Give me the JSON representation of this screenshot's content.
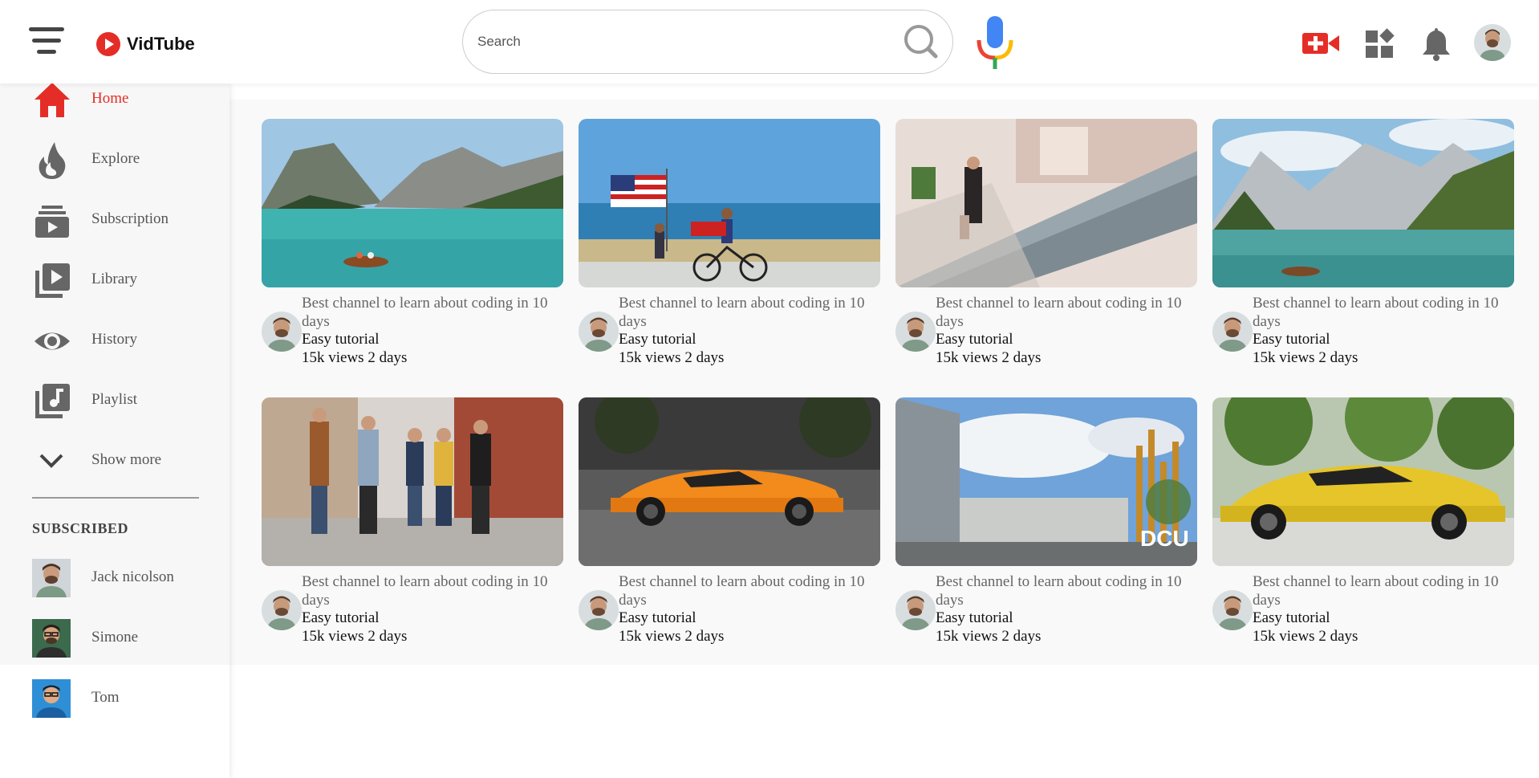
{
  "app": {
    "name": "VidTube",
    "brand_color": "#e52d27"
  },
  "header": {
    "menu_icon": "hamburger-icon",
    "search": {
      "placeholder": "Search",
      "value": "",
      "icon": "search-icon"
    },
    "mic_icon": "mic-icon",
    "actions": [
      {
        "name": "upload-video",
        "icon": "video-add-icon"
      },
      {
        "name": "apps",
        "icon": "apps-grid-icon"
      },
      {
        "name": "notifications",
        "icon": "bell-icon"
      },
      {
        "name": "account",
        "icon": "avatar"
      }
    ]
  },
  "sidebar": {
    "items": [
      {
        "label": "Home",
        "icon": "home-icon",
        "active": true
      },
      {
        "label": "Explore",
        "icon": "flame-icon",
        "active": false
      },
      {
        "label": "Subscription",
        "icon": "subscription-icon",
        "active": false
      },
      {
        "label": "Library",
        "icon": "library-icon",
        "active": false
      },
      {
        "label": "History",
        "icon": "eye-icon",
        "active": false
      },
      {
        "label": "Playlist",
        "icon": "playlist-icon",
        "active": false
      },
      {
        "label": "Show more",
        "icon": "chevron-down-icon",
        "active": false
      }
    ],
    "subscribed_title": "SUBSCRIBED",
    "subscriptions": [
      {
        "name": "Jack nicolson"
      },
      {
        "name": "Simone"
      },
      {
        "name": "Tom"
      }
    ]
  },
  "videos": [
    {
      "title": "Best channel to learn about coding in 10 days",
      "channel": "Easy tutorial",
      "meta": "15k views 2 days",
      "thumb": "lake-with-boat"
    },
    {
      "title": "Best channel to learn about coding in 10 days",
      "channel": "Easy tutorial",
      "meta": "15k views 2 days",
      "thumb": "beach-flag-cyclist"
    },
    {
      "title": "Best channel to learn about coding in 10 days",
      "channel": "Easy tutorial",
      "meta": "15k views 2 days",
      "thumb": "mall-escalator"
    },
    {
      "title": "Best channel to learn about coding in 10 days",
      "channel": "Easy tutorial",
      "meta": "15k views 2 days",
      "thumb": "mountain-lake"
    },
    {
      "title": "Best channel to learn about coding in 10 days",
      "channel": "Easy tutorial",
      "meta": "15k views 2 days",
      "thumb": "friends-walking"
    },
    {
      "title": "Best channel to learn about coding in 10 days",
      "channel": "Easy tutorial",
      "meta": "15k views 2 days",
      "thumb": "orange-sports-car"
    },
    {
      "title": "Best channel to learn about coding in 10 days",
      "channel": "Easy tutorial",
      "meta": "15k views 2 days",
      "thumb": "campus-building"
    },
    {
      "title": "Best channel to learn about coding in 10 days",
      "channel": "Easy tutorial",
      "meta": "15k views 2 days",
      "thumb": "yellow-sports-car"
    }
  ],
  "thumb_dcu_text": "DCU"
}
